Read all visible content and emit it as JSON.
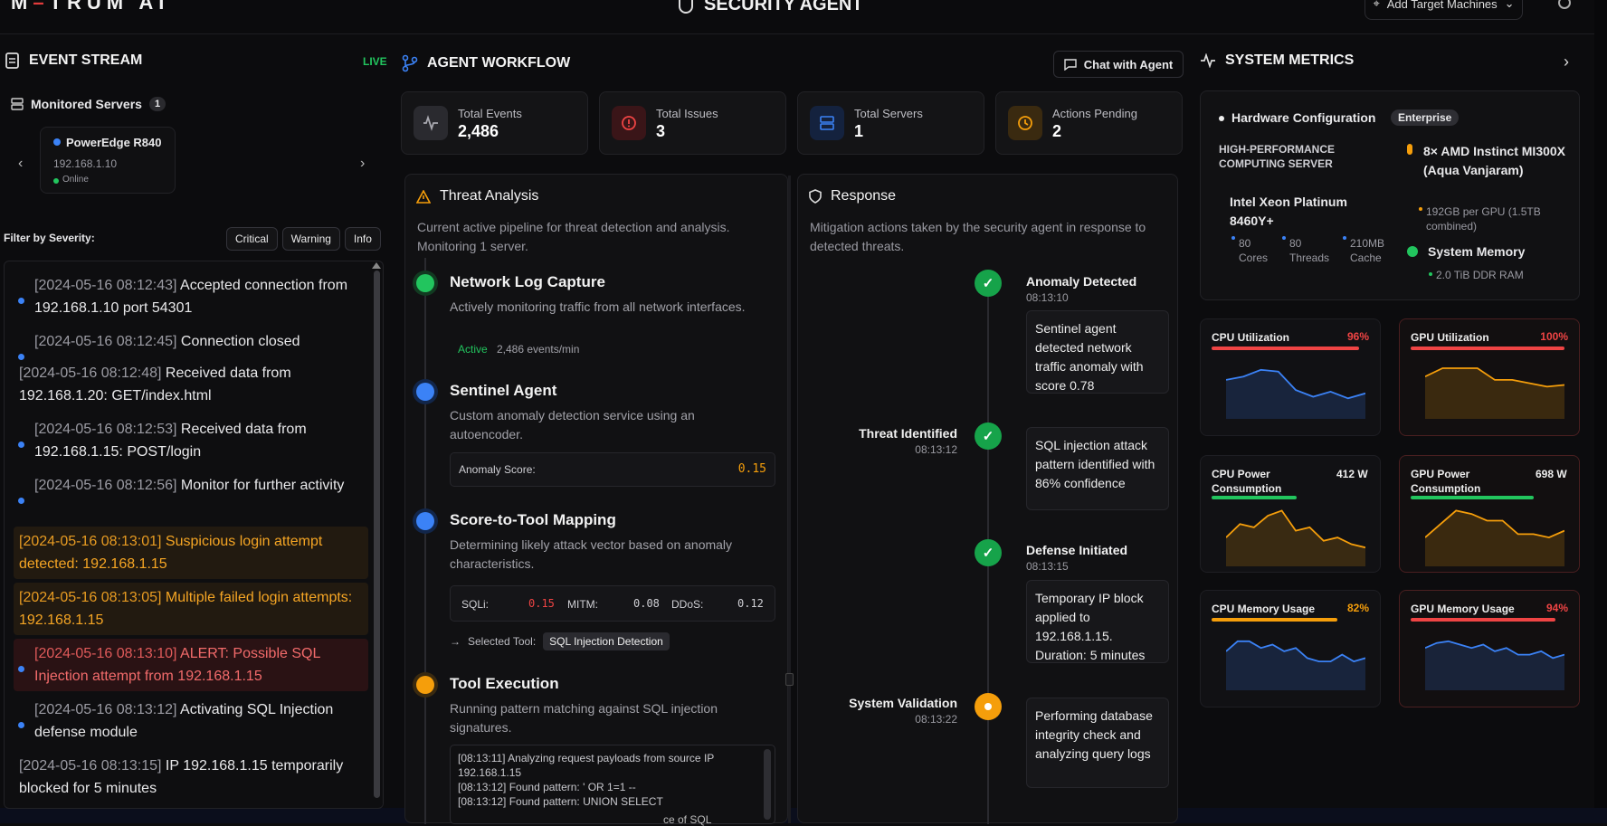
{
  "top": {
    "logo_left": "M",
    "logo_mid": "–",
    "logo_right": "TRUM AI",
    "title": "SECURITY AGENT",
    "target_button": "Add Target Machines"
  },
  "event_stream": {
    "title": "EVENT STREAM",
    "live": "LIVE",
    "monitored_label": "Monitored Servers",
    "monitored_count": "1",
    "server": {
      "name": "PowerEdge R840",
      "ip": "192.168.1.10",
      "status": "Online"
    },
    "filter_label": "Filter by Severity:",
    "filters": [
      "Critical",
      "Warning",
      "Info"
    ],
    "events": [
      {
        "ts": "[2024-05-16 08:12:43]",
        "text": "Accepted connection from 192.168.1.10 port 54301",
        "level": "info",
        "dot": true
      },
      {
        "ts": "[2024-05-16 08:12:45]",
        "text": "Connection closed",
        "level": "info",
        "dot": true
      },
      {
        "ts": "[2024-05-16 08:12:48]",
        "text": "Received data from 192.168.1.20: GET/index.html",
        "level": "info",
        "dot": false
      },
      {
        "ts": "[2024-05-16 08:12:53]",
        "text": "Received data from 192.168.1.15: POST/login",
        "level": "info",
        "dot": true
      },
      {
        "ts": "[2024-05-16 08:12:56]",
        "text": "Monitor for further activity",
        "level": "info",
        "dot": true
      },
      {
        "ts": "[2024-05-16 08:13:01]",
        "text": "Suspicious login attempt detected: 192.168.1.15",
        "level": "warn",
        "dot": false
      },
      {
        "ts": "[2024-05-16 08:13:05]",
        "text": "Multiple failed login attempts: 192.168.1.15",
        "level": "warn",
        "dot": false
      },
      {
        "ts": "[2024-05-16 08:13:10]",
        "text": "ALERT: Possible SQL Injection attempt from 192.168.1.15",
        "level": "crit",
        "dot": true
      },
      {
        "ts": "[2024-05-16 08:13:12]",
        "text": "Activating SQL Injection defense module",
        "level": "info",
        "dot": true
      },
      {
        "ts": "[2024-05-16 08:13:15]",
        "text": "IP 192.168.1.15 temporarily blocked for 5 minutes",
        "level": "info",
        "dot": false
      }
    ]
  },
  "workflow": {
    "title": "AGENT WORKFLOW",
    "chat_button": "Chat with Agent",
    "stats": [
      {
        "label": "Total Events",
        "value": "2,486",
        "icon": "activity-icon",
        "color": "#a9a9b0",
        "bg": "#2a2a2f"
      },
      {
        "label": "Total Issues",
        "value": "3",
        "icon": "alert-circle-icon",
        "color": "#ef4444",
        "bg": "#3a1518"
      },
      {
        "label": "Total Servers",
        "value": "1",
        "icon": "server-icon",
        "color": "#3b82f6",
        "bg": "#14223e"
      },
      {
        "label": "Actions Pending",
        "value": "2",
        "icon": "clock-icon",
        "color": "#f59e0b",
        "bg": "#3a2a10"
      }
    ],
    "threat": {
      "title": "Threat Analysis",
      "desc": "Current active pipeline for threat detection and analysis. Monitoring 1 server.",
      "steps": [
        {
          "title": "Network Log Capture",
          "desc": "Actively monitoring traffic from all network interfaces.",
          "color": "#22c55e"
        },
        {
          "title": "Sentinel Agent",
          "desc": "Custom anomaly detection service using an autoencoder.",
          "color": "#3b82f6"
        },
        {
          "title": "Score-to-Tool Mapping",
          "desc": "Determining likely attack vector based on anomaly characteristics.",
          "color": "#3b82f6"
        },
        {
          "title": "Tool Execution",
          "desc": "Running pattern matching against SQL injection signatures.",
          "color": "#f59e0b"
        }
      ],
      "active_label": "Active",
      "active_rate": "2,486 events/min",
      "anomaly_label": "Anomaly Score:",
      "anomaly_value": "0.15",
      "scores": {
        "sqli_label": "SQLi:",
        "sqli": "0.15",
        "mitm_label": "MITM:",
        "mitm": "0.08",
        "ddos_label": "DDoS:",
        "ddos": "0.12"
      },
      "selected_label": "Selected Tool:",
      "selected_tool": "SQL Injection Detection",
      "log": [
        "[08:13:11] Analyzing request payloads from source IP 192.168.1.15",
        "[08:13:12] Found pattern: ' OR 1=1 --",
        "[08:13:12] Found pattern: UNION SELECT"
      ],
      "cut_text": "ce of SQL"
    },
    "response": {
      "title": "Response",
      "desc": "Mitigation actions taken by the security agent in response to detected threats.",
      "items": [
        {
          "title": "Anomaly Detected",
          "time": "08:13:10",
          "text": "Sentinel agent detected network traffic anomaly with score 0.78",
          "status": "done"
        },
        {
          "title": "Threat Identified",
          "time": "08:13:12",
          "text": "SQL injection attack pattern identified with 86% confidence",
          "status": "done"
        },
        {
          "title": "Defense Initiated",
          "time": "08:13:15",
          "text": "Temporary IP block applied to 192.168.1.15. Duration: 5 minutes",
          "status": "done"
        },
        {
          "title": "System Validation",
          "time": "08:13:22",
          "text": "Performing database integrity check and analyzing query logs",
          "status": "pending"
        }
      ]
    }
  },
  "metrics": {
    "title": "SYSTEM METRICS",
    "hw_title": "Hardware Configuration",
    "hw_badge": "Enterprise",
    "hw_class": "HIGH-PERFORMANCE COMPUTING SERVER",
    "cpu_name": "Intel Xeon Platinum 8460Y+",
    "cpu_specs": [
      {
        "v": "80",
        "l": "Cores"
      },
      {
        "v": "80",
        "l": "Threads"
      },
      {
        "v": "210MB",
        "l": "Cache"
      }
    ],
    "gpu_name": "8× AMD Instinct MI300X (Aqua Vanjaram)",
    "gpu_mem": "192GB per GPU (1.5TB combined)",
    "sysmem_title": "System Memory",
    "sysmem_value": "2.0 TiB DDR RAM",
    "cards": [
      {
        "title": "CPU Utilization",
        "value": "96%",
        "color": "#ef4444",
        "chart": "#3b82f6",
        "level": 0.96,
        "series": [
          20,
          22,
          26,
          25,
          14,
          10,
          13,
          9,
          12
        ]
      },
      {
        "title": "GPU Utilization",
        "value": "100%",
        "color": "#ef4444",
        "chart": "#f59e0b",
        "level": 1.0,
        "series": [
          22,
          27,
          27,
          27,
          20,
          20,
          18,
          16,
          17
        ]
      },
      {
        "title": "CPU Power Consumption",
        "value": "412 W",
        "color": "#22c55e",
        "chart": "#f59e0b",
        "level": 0.55,
        "series": [
          14,
          22,
          20,
          27,
          30,
          18,
          20,
          12,
          14,
          10,
          8
        ]
      },
      {
        "title": "GPU Power Consumption",
        "value": "698 W",
        "color": "#22c55e",
        "chart": "#f59e0b",
        "level": 0.8,
        "series": [
          14,
          22,
          30,
          28,
          24,
          24,
          16,
          16,
          14,
          18
        ]
      },
      {
        "title": "CPU Memory Usage",
        "value": "82%",
        "color": "#f59e0b",
        "chart": "#3b82f6",
        "level": 0.82,
        "series": [
          20,
          26,
          26,
          22,
          24,
          20,
          22,
          16,
          14,
          14,
          18,
          14,
          16
        ]
      },
      {
        "title": "GPU Memory Usage",
        "value": "94%",
        "color": "#ef4444",
        "chart": "#3b82f6",
        "level": 0.94,
        "series": [
          22,
          25,
          26,
          24,
          22,
          24,
          20,
          22,
          18,
          18,
          20,
          16,
          18
        ]
      }
    ]
  }
}
